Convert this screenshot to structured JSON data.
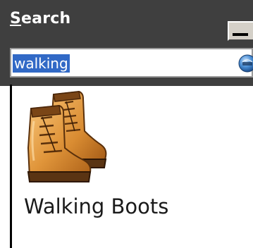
{
  "panel": {
    "title_accel": "S",
    "title_rest": "earch"
  },
  "search": {
    "query": "walking",
    "go_icon": "go-icon"
  },
  "results": [
    {
      "label": "Walking Boots",
      "icon": "walking-boots-icon"
    }
  ],
  "colors": {
    "header_bg": "#3f3f3f",
    "selection_bg": "#3169c6",
    "boot_leather": "#d98c32",
    "go_button": "#4a8ed4"
  }
}
